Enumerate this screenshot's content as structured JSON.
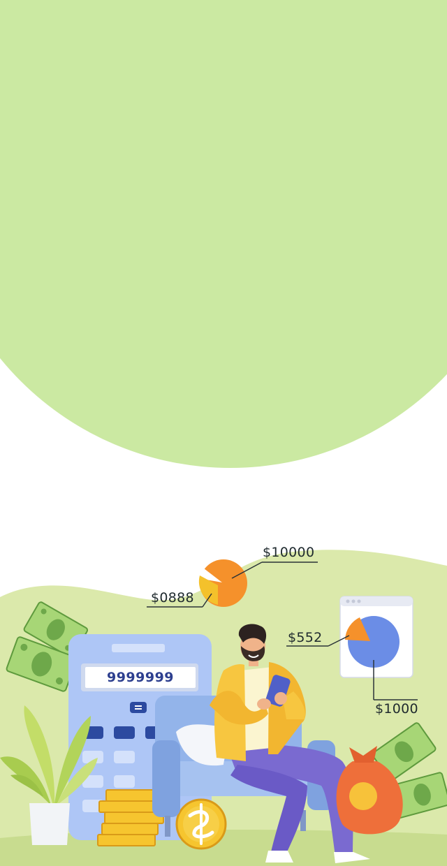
{
  "labels": {
    "top_pie_value": "$10000",
    "left_pie_value": "$0888",
    "panel_slice_value": "$552",
    "panel_total_value": "$1000"
  },
  "calculator": {
    "display": "9999999"
  },
  "colors": {
    "top_blob": "#cbe9a2",
    "hills": "#dbe9ab",
    "calculator": "#aec6f6",
    "pie_orange": "#f5912b",
    "pie_yellow": "#f4c12b",
    "pie_blue": "#6b8de6",
    "jacket": "#f7c640",
    "pants": "#7a6ad0",
    "bag": "#ee6f3a"
  }
}
